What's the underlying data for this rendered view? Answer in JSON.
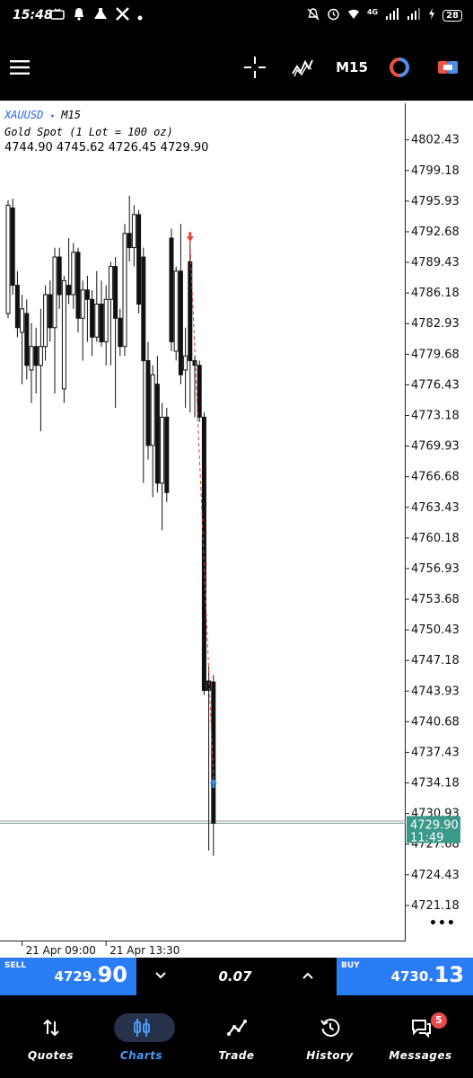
{
  "status_bar": {
    "time": "15:48",
    "left_icons": [
      "tv-icon",
      "bell-icon",
      "flask-icon",
      "x-icon",
      "dot-icon"
    ],
    "network": "4G",
    "battery": "28"
  },
  "toolbar": {
    "timeframe": "M15"
  },
  "chart": {
    "symbol": "XAUUSD",
    "symbol_sep": "▾",
    "timeframe": "M15",
    "description": "Gold Spot (1 Lot = 100 oz)",
    "ohlc": "4744.90 4745.62 4726.45 4729.90",
    "more_glyph": "•••"
  },
  "chart_data": {
    "type": "candlestick",
    "symbol": "XAUUSD",
    "timeframe": "M15",
    "y_ticks": [
      "4802.43",
      "4799.18",
      "4795.93",
      "4792.68",
      "4789.43",
      "4786.18",
      "4782.93",
      "4779.68",
      "4776.43",
      "4773.18",
      "4769.93",
      "4766.68",
      "4763.43",
      "4760.18",
      "4756.93",
      "4753.68",
      "4750.43",
      "4747.18",
      "4743.93",
      "4740.68",
      "4737.43",
      "4734.18",
      "4730.93",
      "4727.68",
      "4724.43",
      "4721.18"
    ],
    "ylim": [
      4718.5,
      4804.5
    ],
    "x_labels": [
      {
        "label": "21 Apr 09:00",
        "index": 3
      },
      {
        "label": "21 Apr 13:30",
        "index": 21
      }
    ],
    "bid_line": {
      "price": "4729.90",
      "countdown": "11:49",
      "value": 4729.9
    },
    "ask_value": 4730.13,
    "trade_line": {
      "open_index": 39,
      "open_price": 4791.6,
      "close_index": 44,
      "close_price": 4734.7
    },
    "candles": [
      {
        "o": 4784.0,
        "h": 4796.0,
        "l": 4783.5,
        "c": 4795.5
      },
      {
        "o": 4795.2,
        "h": 4796.2,
        "l": 4786.0,
        "c": 4787.0
      },
      {
        "o": 4787.0,
        "h": 4788.5,
        "l": 4781.5,
        "c": 4782.5
      },
      {
        "o": 4782.0,
        "h": 4786.0,
        "l": 4776.5,
        "c": 4784.5
      },
      {
        "o": 4784.0,
        "h": 4785.5,
        "l": 4777.0,
        "c": 4778.5
      },
      {
        "o": 4778.0,
        "h": 4783.0,
        "l": 4774.5,
        "c": 4780.5
      },
      {
        "o": 4780.5,
        "h": 4782.5,
        "l": 4775.5,
        "c": 4778.5
      },
      {
        "o": 4778.5,
        "h": 4784.5,
        "l": 4771.5,
        "c": 4780.5
      },
      {
        "o": 4780.5,
        "h": 4787.0,
        "l": 4779.0,
        "c": 4786.0
      },
      {
        "o": 4786.0,
        "h": 4787.5,
        "l": 4781.0,
        "c": 4782.5
      },
      {
        "o": 4782.5,
        "h": 4791.0,
        "l": 4775.5,
        "c": 4790.0
      },
      {
        "o": 4790.0,
        "h": 4791.0,
        "l": 4784.5,
        "c": 4786.0
      },
      {
        "o": 4776.0,
        "h": 4788.0,
        "l": 4774.5,
        "c": 4787.5
      },
      {
        "o": 4787.0,
        "h": 4792.0,
        "l": 4785.0,
        "c": 4786.0
      },
      {
        "o": 4786.0,
        "h": 4791.5,
        "l": 4784.5,
        "c": 4790.5
      },
      {
        "o": 4790.5,
        "h": 4791.0,
        "l": 4782.0,
        "c": 4783.5
      },
      {
        "o": 4783.5,
        "h": 4787.5,
        "l": 4779.0,
        "c": 4786.5
      },
      {
        "o": 4786.5,
        "h": 4788.0,
        "l": 4781.0,
        "c": 4785.5
      },
      {
        "o": 4785.5,
        "h": 4786.5,
        "l": 4779.5,
        "c": 4781.5
      },
      {
        "o": 4781.5,
        "h": 4788.5,
        "l": 4781.0,
        "c": 4785.0
      },
      {
        "o": 4785.0,
        "h": 4787.5,
        "l": 4780.5,
        "c": 4781.0
      },
      {
        "o": 4781.0,
        "h": 4787.0,
        "l": 4778.5,
        "c": 4785.5
      },
      {
        "o": 4785.5,
        "h": 4789.5,
        "l": 4778.5,
        "c": 4789.0
      },
      {
        "o": 4789.0,
        "h": 4790.0,
        "l": 4774.0,
        "c": 4783.5
      },
      {
        "o": 4783.5,
        "h": 4784.5,
        "l": 4779.5,
        "c": 4780.5
      },
      {
        "o": 4780.5,
        "h": 4793.5,
        "l": 4779.5,
        "c": 4792.5
      },
      {
        "o": 4792.5,
        "h": 4796.5,
        "l": 4789.5,
        "c": 4791.0
      },
      {
        "o": 4791.0,
        "h": 4795.5,
        "l": 4789.0,
        "c": 4794.5
      },
      {
        "o": 4794.5,
        "h": 4795.0,
        "l": 4784.0,
        "c": 4785.0
      },
      {
        "o": 4790.0,
        "h": 4791.0,
        "l": 4766.0,
        "c": 4779.0
      },
      {
        "o": 4779.0,
        "h": 4781.0,
        "l": 4768.5,
        "c": 4770.0
      },
      {
        "o": 4770.0,
        "h": 4778.5,
        "l": 4764.5,
        "c": 4777.5
      },
      {
        "o": 4776.5,
        "h": 4779.5,
        "l": 4765.0,
        "c": 4766.0
      },
      {
        "o": 4766.0,
        "h": 4774.5,
        "l": 4761.0,
        "c": 4773.0
      },
      {
        "o": 4773.0,
        "h": 4774.0,
        "l": 4764.0,
        "c": 4765.0
      },
      {
        "o": 4792.0,
        "h": 4793.0,
        "l": 4780.0,
        "c": 4781.0
      },
      {
        "o": 4780.0,
        "h": 4789.0,
        "l": 4779.0,
        "c": 4788.5
      },
      {
        "o": 4788.5,
        "h": 4793.5,
        "l": 4776.5,
        "c": 4777.5
      },
      {
        "o": 4778.0,
        "h": 4782.5,
        "l": 4774.0,
        "c": 4779.5
      },
      {
        "o": 4789.5,
        "h": 4792.0,
        "l": 4773.5,
        "c": 4779.0
      },
      {
        "o": 4779.0,
        "h": 4779.5,
        "l": 4773.0,
        "c": 4778.5
      },
      {
        "o": 4778.5,
        "h": 4779.0,
        "l": 4772.5,
        "c": 4773.0
      },
      {
        "o": 4773.0,
        "h": 4773.5,
        "l": 4743.5,
        "c": 4744.0
      },
      {
        "o": 4745.0,
        "h": 4746.5,
        "l": 4727.0,
        "c": 4744.0
      },
      {
        "o": 4744.9,
        "h": 4745.62,
        "l": 4726.45,
        "c": 4729.9
      }
    ]
  },
  "trade_panel": {
    "sell_label": "SELL",
    "sell_price_main": "4729.",
    "sell_price_big": "90",
    "volume": "0.07",
    "buy_label": "BUY",
    "buy_price_main": "4730.",
    "buy_price_big": "13"
  },
  "bottom_nav": {
    "items": [
      {
        "label": "Quotes"
      },
      {
        "label": "Charts"
      },
      {
        "label": "Trade"
      },
      {
        "label": "History"
      },
      {
        "label": "Messages"
      }
    ],
    "messages_badge": "5"
  },
  "colors": {
    "accent": "#2b7df5",
    "bg": "#000000",
    "chart_bg": "#ffffff",
    "bid_label": "#3a9a8a",
    "sell_marker": "#e0453a",
    "buy_marker": "#3a8ae0",
    "nav_active": "#4a9af5",
    "badge": "#e84a4a"
  }
}
